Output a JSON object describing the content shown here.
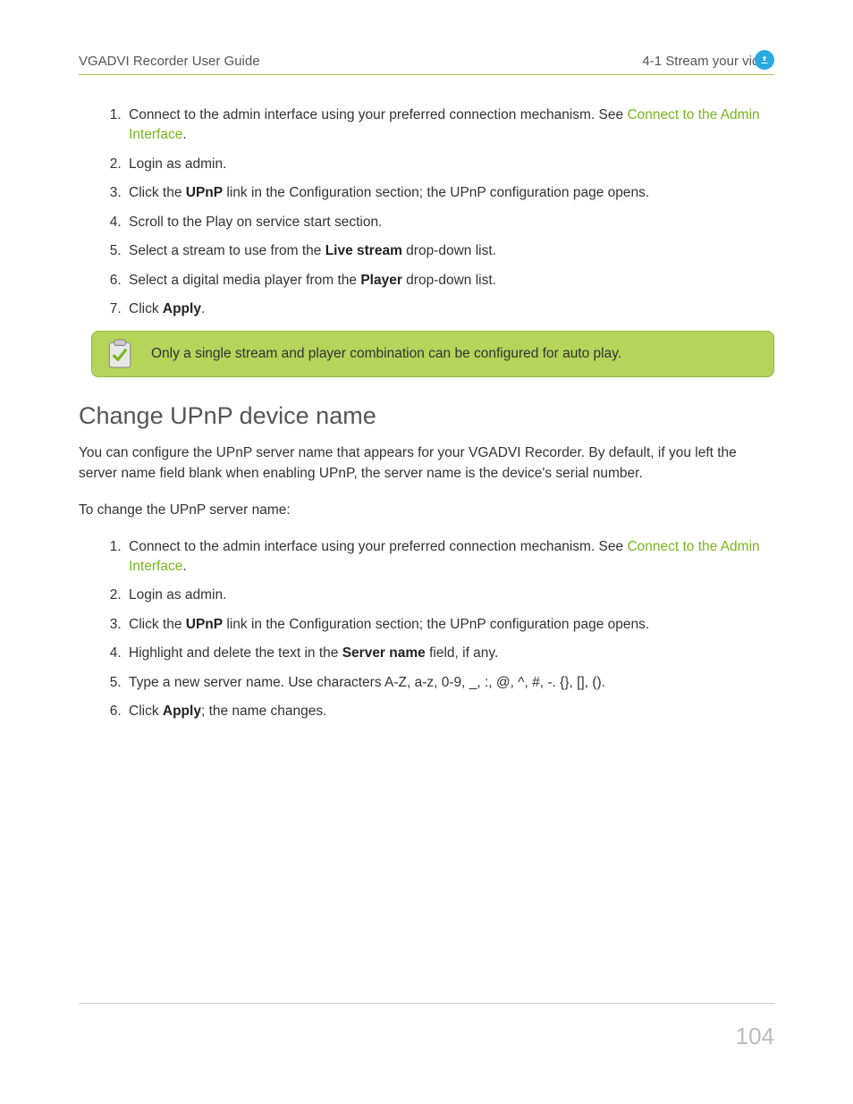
{
  "header": {
    "left": "VGADVI Recorder User Guide",
    "right": "4-1 Stream your video"
  },
  "list1": {
    "item1_a": "Connect to the admin interface using your preferred connection mechanism. See ",
    "item1_link": "Connect to the Admin Interface",
    "item1_b": ".",
    "item2": "Login as admin.",
    "item3_a": "Click the ",
    "item3_bold": "UPnP",
    "item3_b": " link in the Configuration section; the UPnP configuration page opens.",
    "item4": "Scroll to the Play on service start section.",
    "item5_a": "Select a stream to use from the ",
    "item5_bold": "Live stream",
    "item5_b": " drop-down list.",
    "item6_a": "Select a digital media player from the ",
    "item6_bold": "Player",
    "item6_b": " drop-down list.",
    "item7_a": "Click ",
    "item7_bold": "Apply",
    "item7_b": "."
  },
  "note": {
    "text": "Only a single stream and player combination can be configured for auto play."
  },
  "section": {
    "heading": "Change UPnP device name",
    "para1": "You can configure the UPnP server name that appears for your VGADVI Recorder. By default, if you left the server name field blank when enabling UPnP, the server name is the device's serial number.",
    "para2": "To change the UPnP server name:"
  },
  "list2": {
    "item1_a": "Connect to the admin interface using your preferred connection mechanism. See ",
    "item1_link": "Connect to the Admin Interface",
    "item1_b": ".",
    "item2": "Login as admin.",
    "item3_a": "Click the ",
    "item3_bold": "UPnP",
    "item3_b": " link in the Configuration section; the UPnP configuration page opens.",
    "item4_a": "Highlight and delete the text in the ",
    "item4_bold": "Server name",
    "item4_b": " field, if any.",
    "item5": "Type a new server name. Use characters A-Z, a-z, 0-9, _, :, @, ^, #, -. {}, [], ().",
    "item6_a": "Click ",
    "item6_bold": "Apply",
    "item6_b": "; the name changes."
  },
  "footer": {
    "page": "104"
  }
}
